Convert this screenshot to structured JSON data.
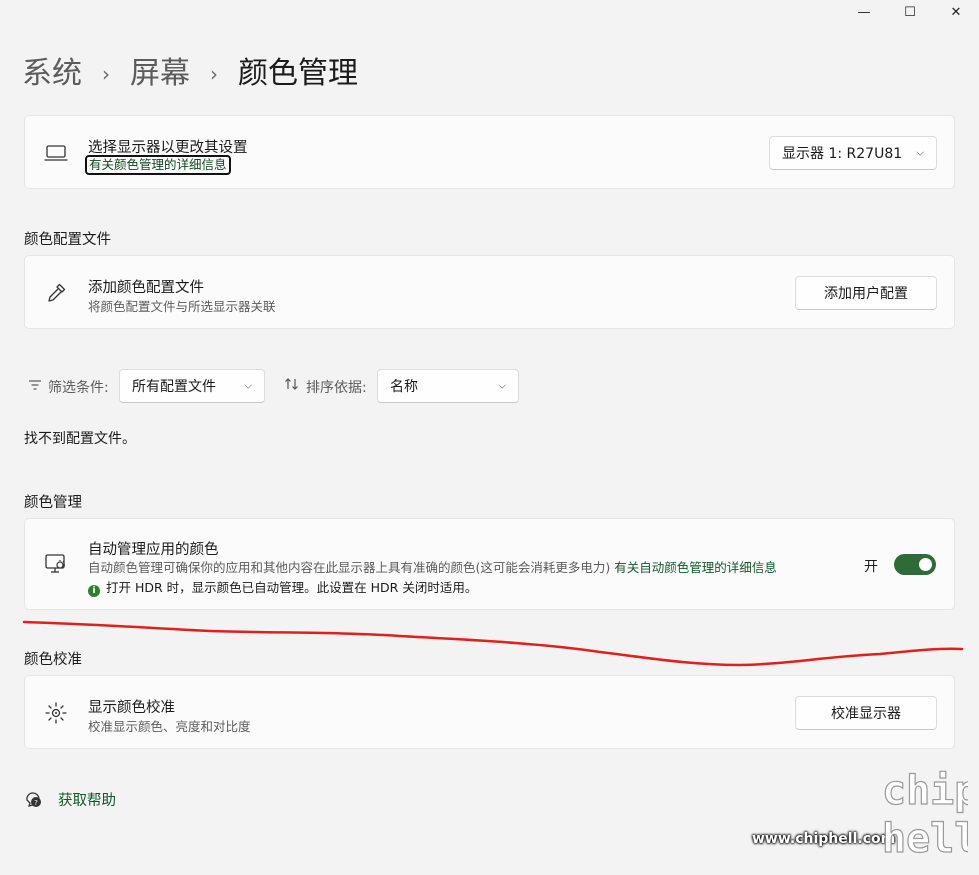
{
  "window": {
    "minimize_glyph": "—",
    "maximize_glyph": "☐",
    "close_glyph": "✕"
  },
  "breadcrumb": {
    "parent1": "系统",
    "parent2": "屏幕",
    "current": "颜色管理",
    "separator": "›"
  },
  "display_select": {
    "title": "选择显示器以更改其设置",
    "link": "有关颜色管理的详细信息",
    "selected": "显示器 1: R27U81",
    "icon": "laptop-icon"
  },
  "profiles_section": {
    "label": "颜色配置文件",
    "add_card": {
      "title": "添加颜色配置文件",
      "subtitle": "将颜色配置文件与所选显示器关联",
      "button": "添加用户配置",
      "icon": "eyedropper-icon"
    },
    "filter": {
      "label": "筛选条件:",
      "value": "所有配置文件"
    },
    "sort": {
      "label": "排序依据:",
      "value": "名称"
    },
    "empty_message": "找不到配置文件。"
  },
  "color_management": {
    "label": "颜色管理",
    "auto_card": {
      "title": "自动管理应用的颜色",
      "description": "自动颜色管理可确保你的应用和其他内容在此显示器上具有准确的颜色(这可能会消耗更多电力)",
      "link": "有关自动颜色管理的详细信息",
      "note": "打开 HDR 时，显示颜色已自动管理。此设置在 HDR 关闭时适用。",
      "toggle_state": "开",
      "toggle_on": true
    }
  },
  "calibration": {
    "label": "颜色校准",
    "card": {
      "title": "显示颜色校准",
      "subtitle": "校准显示颜色、亮度和对比度",
      "button": "校准显示器",
      "icon": "calibration-icon"
    }
  },
  "help": {
    "label": "获取帮助",
    "icon": "help-icon"
  },
  "watermark": {
    "url": "www.chiphell.com",
    "logo_text": "chip hell"
  },
  "colors": {
    "accent": "#2e6b37",
    "link": "#0f5a27",
    "annotation": "#e0201a"
  }
}
